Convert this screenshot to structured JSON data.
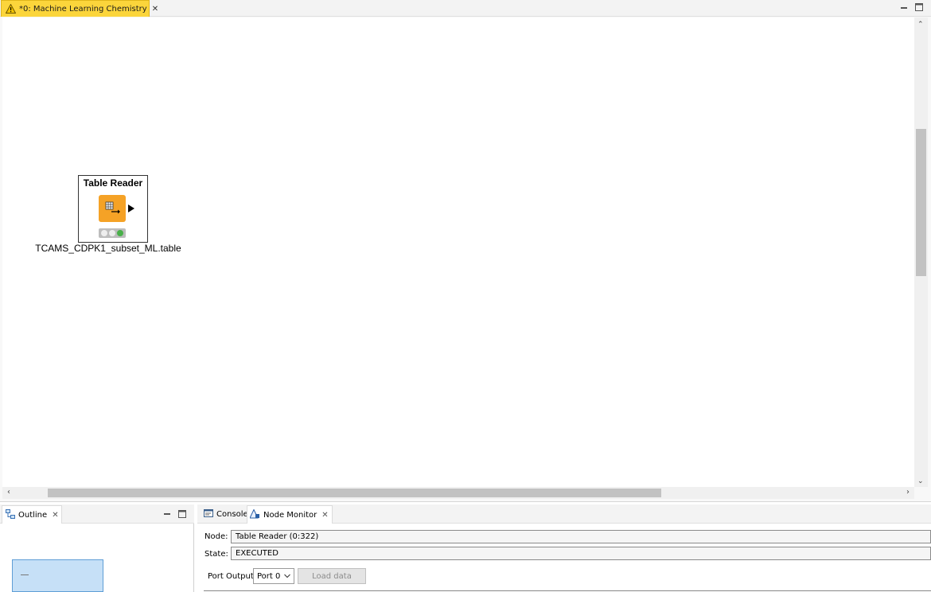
{
  "editor": {
    "tab_label": "*0: Machine Learning Chemistry",
    "tab_icon": "warning-icon",
    "accent_tab_color": "#fbd53b"
  },
  "workflow": {
    "node": {
      "title": "Table Reader",
      "label": "TCAMS_CDPK1_subset_ML.table",
      "icon": "table-reader-icon",
      "icon_color": "#f5a226",
      "status": "executed",
      "status_color": "#49b04a"
    }
  },
  "outline": {
    "tab_label": "Outline",
    "icon": "outline-icon"
  },
  "monitor": {
    "tabs": [
      {
        "label": "Console",
        "icon": "console-icon"
      },
      {
        "label": "Node Monitor",
        "icon": "node-monitor-icon"
      }
    ],
    "node_label": "Node:",
    "node_value": "Table Reader  (0:322)",
    "state_label": "State:",
    "state_value": "EXECUTED",
    "port_output_label": "Port Output",
    "port_selected": "Port 0",
    "load_button": "Load data"
  }
}
